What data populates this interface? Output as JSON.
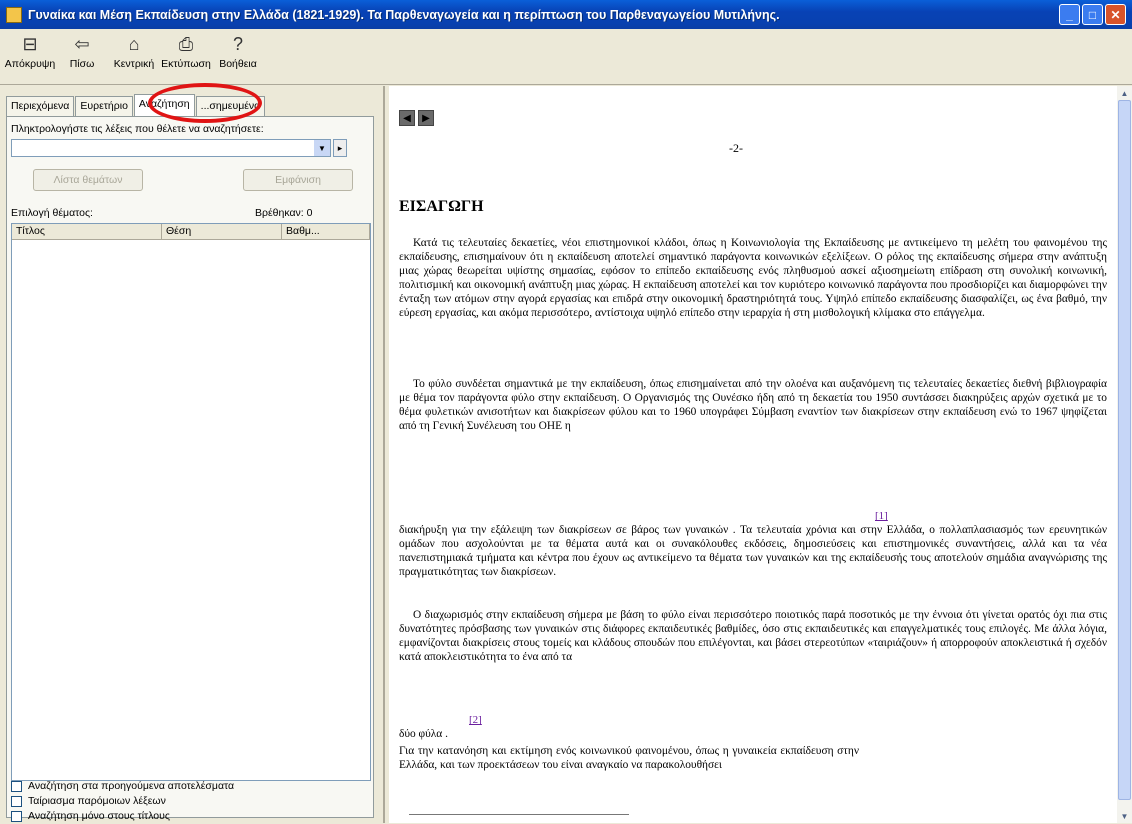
{
  "window": {
    "title": "Γυναίκα και Μέση Εκπαίδευση στην Ελλάδα (1821-1929). Τα Παρθεναγωγεία και η περίπτωση του Παρθεναγωγείου Μυτιλήνης.",
    "minimize": "_",
    "maximize": "□",
    "close": "✕"
  },
  "toolbar": [
    {
      "label": "Απόκρυψη",
      "icon": "hide-icon",
      "glyph": "⊟"
    },
    {
      "label": "Πίσω",
      "icon": "back-arrow-icon",
      "glyph": "⇦"
    },
    {
      "label": "Κεντρική",
      "icon": "home-icon",
      "glyph": "⌂"
    },
    {
      "label": "Εκτύπωση",
      "icon": "print-icon",
      "glyph": "⎙"
    },
    {
      "label": "Βοήθεια",
      "icon": "help-icon",
      "glyph": "?"
    }
  ],
  "tabs": [
    {
      "label": "Περιεχόμενα"
    },
    {
      "label": "Ευρετήριο"
    },
    {
      "label": "Αναζήτηση"
    },
    {
      "label": "...σημευμένα"
    }
  ],
  "search": {
    "prompt": "Πληκτρολογήστε τις λέξεις που θέλετε να αναζητήσετε:",
    "value": "",
    "list_topics_button": "Λίστα θεμάτων",
    "display_button": "Εμφάνιση",
    "select_topic_label": "Επιλογή θέματος:",
    "found_label": "Βρέθηκαν: 0",
    "columns": [
      "Τίτλος",
      "Θέση",
      "Βαθμ..."
    ]
  },
  "options": [
    "Αναζήτηση στα προηγούμενα αποτελέσματα",
    "Ταίριασμα παρόμοιων λέξεων",
    "Αναζήτηση μόνο στους τίτλους"
  ],
  "document": {
    "page_number": "-2-",
    "heading": "ΕΙΣΑΓΩΓΗ",
    "p1": "Κατά τις τελευταίες δεκαετίες, νέοι επιστημονικοί κλάδοι, όπως η Κοινωνιολογία της Εκπαίδευσης με αντικείμενο τη μελέτη του φαινομένου της εκπαίδευσης, επισημαίνουν ότι η εκπαίδευση αποτελεί σημαντικό παράγοντα κοινωνικών εξελίξεων. Ο ρόλος της εκπαίδευσης σήμερα στην ανάπτυξη μιας χώρας θεωρείται υψίστης σημασίας, εφόσον το επίπεδο εκπαίδευσης ενός πληθυσμού ασκεί αξιοσημείωτη επίδραση στη συνολική κοινωνική, πολιτισμική και οικονομική ανάπτυξη μιας χώρας. Η εκπαίδευση αποτελεί και τον κυριότερο κοινωνικό παράγοντα που προσδιορίζει και διαμορφώνει την ένταξη των ατόμων στην αγορά εργασίας και επιδρά στην οικονομική δραστηριότητά τους. Υψηλό επίπεδο εκπαίδευσης διασφαλίζει, ως ένα βαθμό, την εύρεση εργασίας, και ακόμα περισσότερο, αντίστοιχα υψηλό επίπεδο στην ιεραρχία ή στη μισθολογική κλίμακα στο επάγγελμα.",
    "p2": "Το φύλο συνδέεται σημαντικά με την εκπαίδευση, όπως επισημαίνεται από την ολοένα και αυξανόμενη τις τελευταίες δεκαετίες διεθνή βιβλιογραφία με θέμα τον παράγοντα φύλο στην εκπαίδευση. Ο Οργανισμός της Ουνέσκο ήδη από τη δεκαετία του 1950 συντάσσει διακηρύξεις αρχών σχετικά με το θέμα φυλετικών ανισοτήτων και διακρίσεων φύλου και το 1960 υπογράφει Σύμβαση εναντίον των διακρίσεων στην εκπαίδευση ενώ το 1967 ψηφίζεται από τη Γενική Συνέλευση του ΟΗΕ η",
    "fn1": "[1]",
    "p3": "διακήρυξη για την εξάλειψη των διακρίσεων σε βάρος των γυναικών . Τα τελευταία χρόνια και στην Ελλάδα, ο πολλαπλασιασμός των ερευνητικών ομάδων που ασχολούνται με τα θέματα αυτά και οι συνακόλουθες εκδόσεις, δημοσιεύσεις και επιστημονικές συναντήσεις, αλλά και τα νέα πανεπιστημιακά τμήματα και κέντρα που έχουν ως αντικείμενο τα θέματα των γυναικών και της εκπαίδευσής τους αποτελούν σημάδια αναγνώρισης της πραγματικότητας των διακρίσεων.",
    "p4": "Ο διαχωρισμός στην εκπαίδευση σήμερα με βάση το φύλο είναι περισσότερο ποιοτικός παρά ποσοτικός με την έννοια ότι γίνεται ορατός όχι πια στις δυνατότητες πρόσβασης των γυναικών στις διάφορες εκπαιδευτικές βαθμίδες, όσο στις εκπαιδευτικές και επαγγελματικές τους επιλογές. Με άλλα λόγια, εμφανίζονται διακρίσεις στους τομείς και κλάδους σπουδών που επιλέγονται, και βάσει στερεοτύπων «ταιριάζουν» ή απορροφούν αποκλειστικά ή σχεδόν κατά αποκλειστικότητα το ένα από τα",
    "fn2": "[2]",
    "p5": "δύο φύλα .",
    "p6": "Για την κατανόηση και εκτίμηση ενός κοινωνικού φαινομένου, όπως η γυναικεία εκπαίδευση στην Ελλάδα, και των προεκτάσεων του είναι αναγκαίο να παρακολουθήσει"
  }
}
